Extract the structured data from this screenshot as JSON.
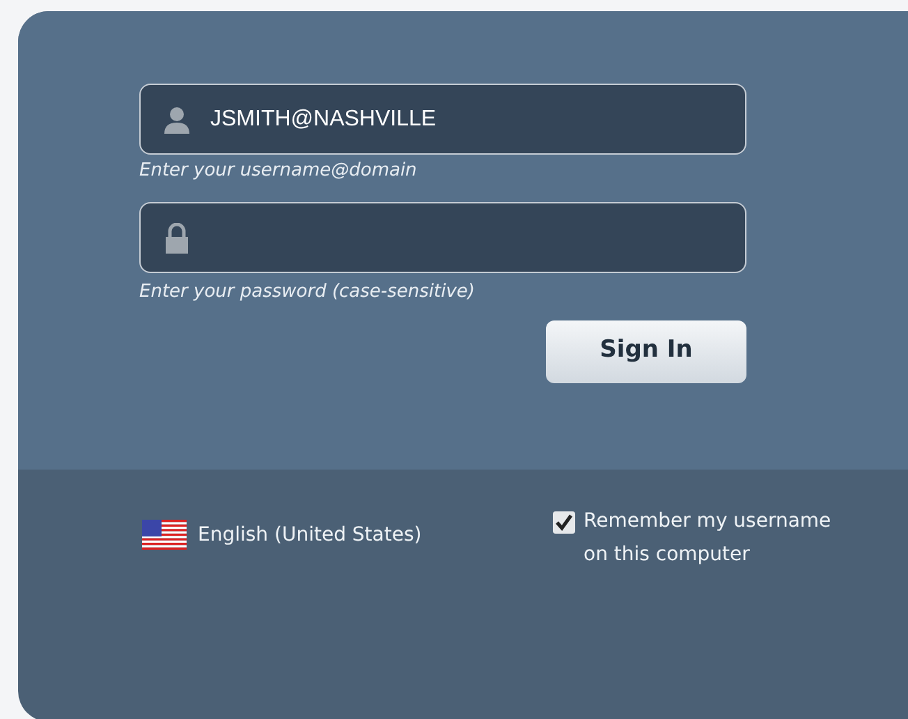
{
  "username_field": {
    "value": "JSMITH@NASHVILLE",
    "hint": "Enter your username@domain"
  },
  "password_field": {
    "hint": "Enter your password (case-sensitive)"
  },
  "sign_in_button": "Sign In",
  "language": "English (United States)",
  "remember": {
    "label": "Remember my username on this computer",
    "checked": true
  }
}
